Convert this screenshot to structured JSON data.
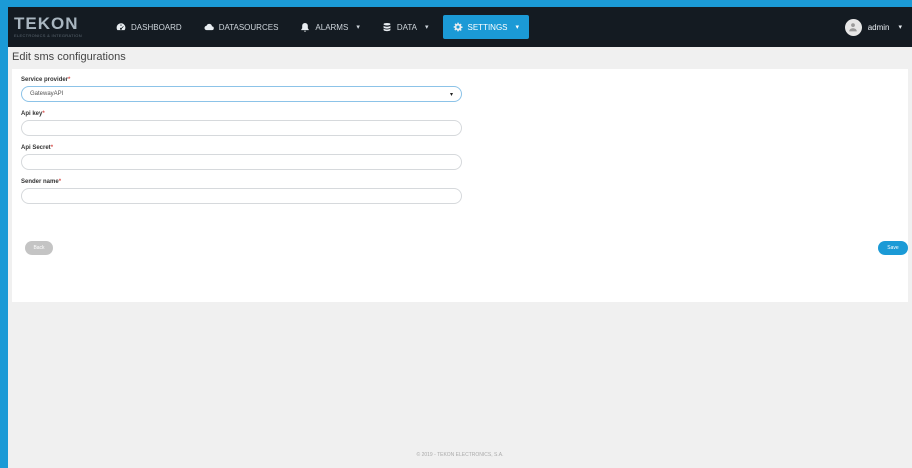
{
  "brand": {
    "logo": "TEKON",
    "subtitle": "ELECTRONICS & INTEGRATION"
  },
  "nav": {
    "items": [
      {
        "label": "DASHBOARD",
        "icon": "gauge-icon",
        "caret": ""
      },
      {
        "label": "DATASOURCES",
        "icon": "cloud-icon",
        "caret": ""
      },
      {
        "label": "ALARMS",
        "icon": "bell-icon",
        "caret": "▾"
      },
      {
        "label": "DATA",
        "icon": "database-icon",
        "caret": "▾"
      },
      {
        "label": "SETTINGS",
        "icon": "gear-icon",
        "caret": "▾"
      }
    ],
    "active": "SETTINGS",
    "user": {
      "name": "admin",
      "caret": "▾"
    }
  },
  "page": {
    "title": "Edit sms configurations"
  },
  "form": {
    "service_provider": {
      "label": "Service provider",
      "required": "*",
      "value": "GatewayAPI"
    },
    "api_key": {
      "label": "Api key",
      "required": "*",
      "value": ""
    },
    "api_secret": {
      "label": "Api Secret",
      "required": "*",
      "value": ""
    },
    "sender_name": {
      "label": "Sender name",
      "required": "*",
      "value": ""
    }
  },
  "actions": {
    "back_label": "Back",
    "save_label": "Save"
  },
  "footer": {
    "text": "© 2019 - TEKON ELECTRONICS, S.A."
  },
  "colors": {
    "navbar": "#141b22",
    "accent": "#1b9ad6",
    "background": "#f0f0f0",
    "required": "#d9534f"
  }
}
